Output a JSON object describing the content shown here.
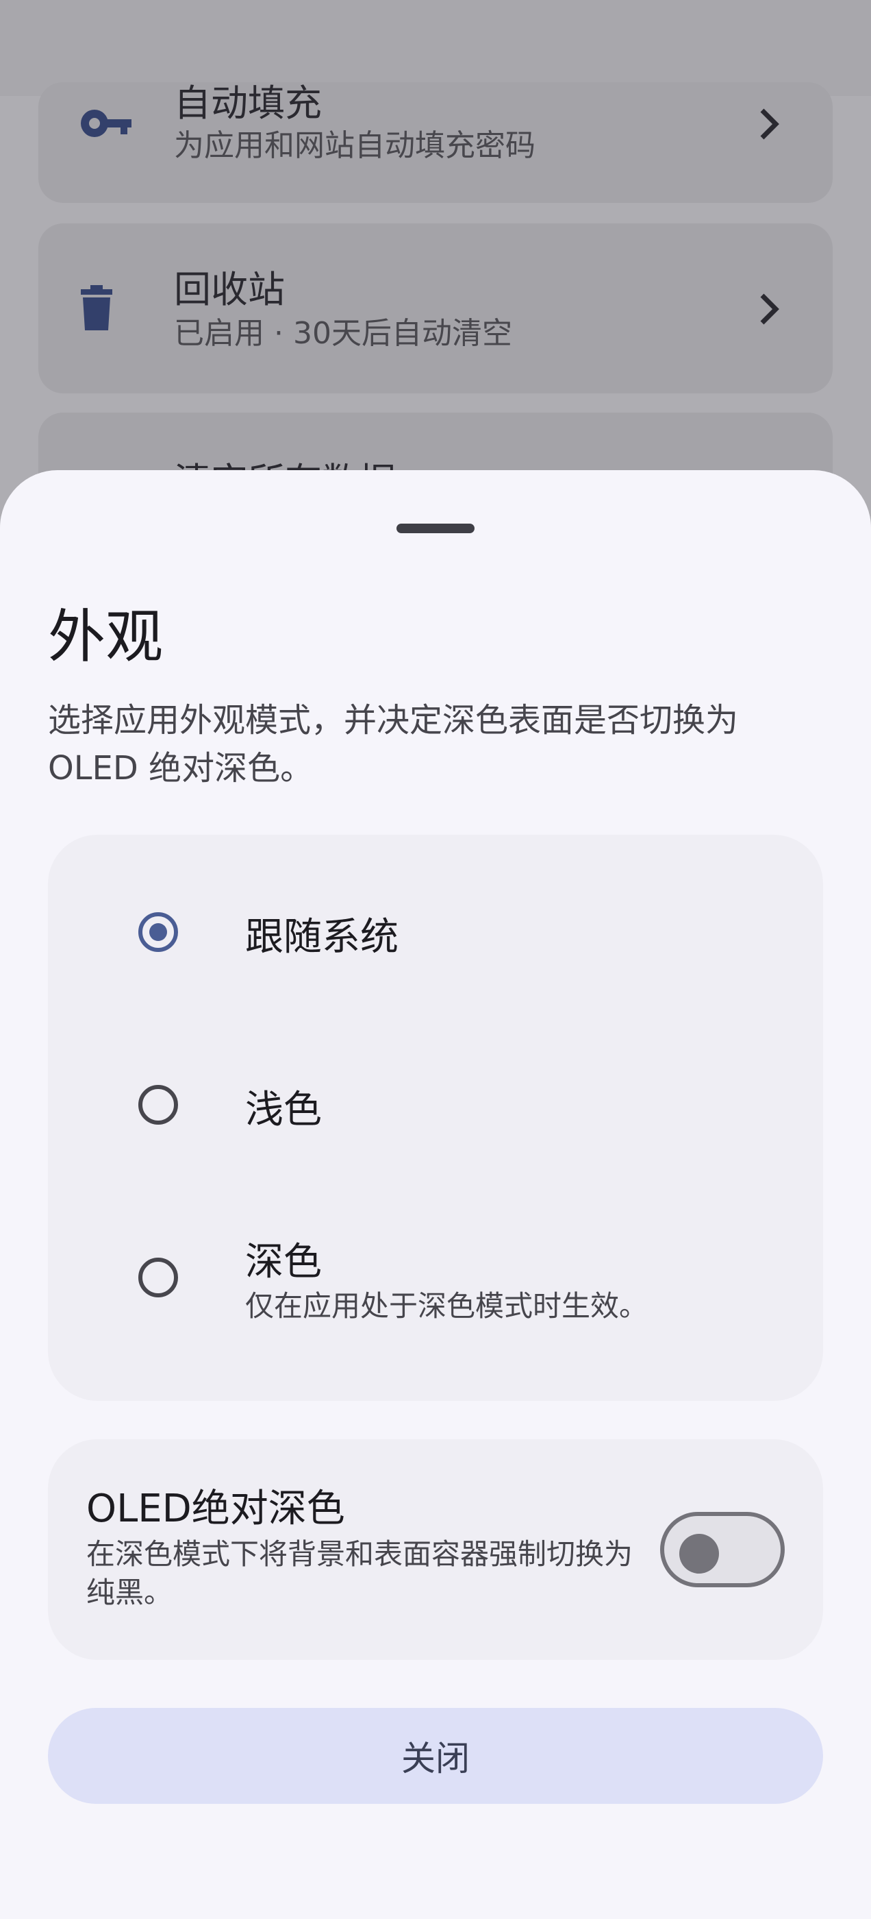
{
  "background": {
    "items": [
      {
        "title": "自动填充",
        "subtitle": "为应用和网站自动填充密码",
        "icon": "key-icon"
      },
      {
        "title": "回收站",
        "subtitle": "已启用 · 30天后自动清空",
        "icon": "trash-icon"
      },
      {
        "title": "清空所有数据",
        "subtitle": "",
        "icon": ""
      }
    ]
  },
  "sheet": {
    "title": "外观",
    "description": "选择应用外观模式，并决定深色表面是否切换为OLED 绝对深色。",
    "options": [
      {
        "label": "跟随系统",
        "subtitle": "",
        "selected": true
      },
      {
        "label": "浅色",
        "subtitle": "",
        "selected": false
      },
      {
        "label": "深色",
        "subtitle": "仅在应用处于深色模式时生效。",
        "selected": false
      }
    ],
    "oled": {
      "title": "OLED绝对深色",
      "description": "在深色模式下将背景和表面容器强制切换为纯黑。",
      "enabled": false
    },
    "close_label": "关闭"
  },
  "colors": {
    "accent": "#4a5d94",
    "close_button_bg": "#dde0f7",
    "scrim": "#aeadb2"
  }
}
